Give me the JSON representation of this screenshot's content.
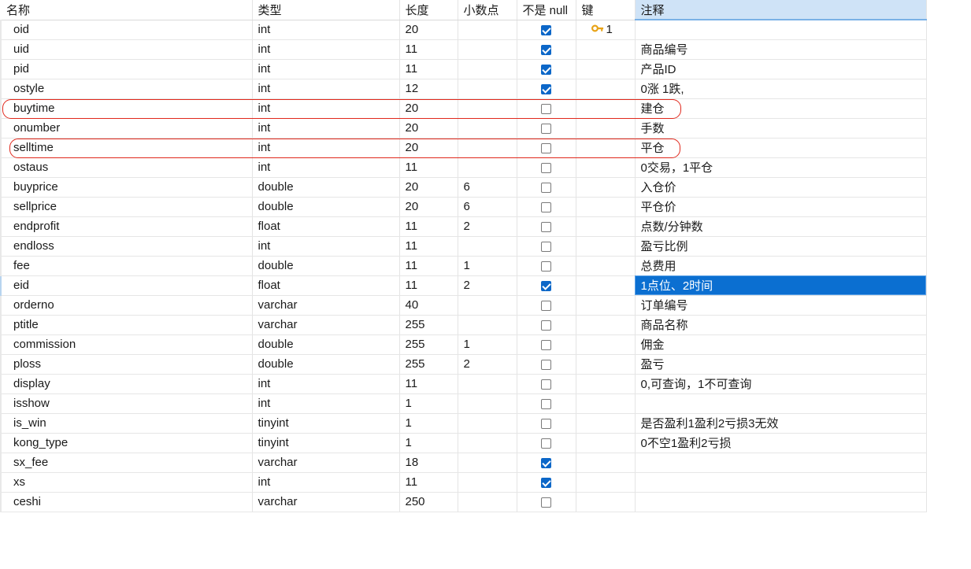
{
  "headers": {
    "name": "名称",
    "type": "类型",
    "length": "长度",
    "decimals": "小数点",
    "not_null": "不是 null",
    "key": "键",
    "comment": "注释"
  },
  "rows": [
    {
      "name": "oid",
      "type": "int",
      "length": "20",
      "decimals": "",
      "not_null": true,
      "key": "1",
      "comment": ""
    },
    {
      "name": "uid",
      "type": "int",
      "length": "11",
      "decimals": "",
      "not_null": true,
      "key": "",
      "comment": "商品编号"
    },
    {
      "name": "pid",
      "type": "int",
      "length": "11",
      "decimals": "",
      "not_null": true,
      "key": "",
      "comment": "产品ID"
    },
    {
      "name": "ostyle",
      "type": "int",
      "length": "12",
      "decimals": "",
      "not_null": true,
      "key": "",
      "comment": "0涨 1跌,"
    },
    {
      "name": "buytime",
      "type": "int",
      "length": "20",
      "decimals": "",
      "not_null": false,
      "key": "",
      "comment": "建仓"
    },
    {
      "name": "onumber",
      "type": "int",
      "length": "20",
      "decimals": "",
      "not_null": false,
      "key": "",
      "comment": "手数"
    },
    {
      "name": "selltime",
      "type": "int",
      "length": "20",
      "decimals": "",
      "not_null": false,
      "key": "",
      "comment": "平仓"
    },
    {
      "name": "ostaus",
      "type": "int",
      "length": "11",
      "decimals": "",
      "not_null": false,
      "key": "",
      "comment": "0交易，1平仓"
    },
    {
      "name": "buyprice",
      "type": "double",
      "length": "20",
      "decimals": "6",
      "not_null": false,
      "key": "",
      "comment": "入仓价"
    },
    {
      "name": "sellprice",
      "type": "double",
      "length": "20",
      "decimals": "6",
      "not_null": false,
      "key": "",
      "comment": "平仓价"
    },
    {
      "name": "endprofit",
      "type": "float",
      "length": "11",
      "decimals": "2",
      "not_null": false,
      "key": "",
      "comment": "点数/分钟数"
    },
    {
      "name": "endloss",
      "type": "int",
      "length": "11",
      "decimals": "",
      "not_null": false,
      "key": "",
      "comment": "盈亏比例"
    },
    {
      "name": "fee",
      "type": "double",
      "length": "11",
      "decimals": "1",
      "not_null": false,
      "key": "",
      "comment": "总费用"
    },
    {
      "name": "eid",
      "type": "float",
      "length": "11",
      "decimals": "2",
      "not_null": true,
      "key": "",
      "comment": "1点位、2时间"
    },
    {
      "name": "orderno",
      "type": "varchar",
      "length": "40",
      "decimals": "",
      "not_null": false,
      "key": "",
      "comment": "订单编号"
    },
    {
      "name": "ptitle",
      "type": "varchar",
      "length": "255",
      "decimals": "",
      "not_null": false,
      "key": "",
      "comment": "商品名称"
    },
    {
      "name": "commission",
      "type": "double",
      "length": "255",
      "decimals": "1",
      "not_null": false,
      "key": "",
      "comment": "佣金"
    },
    {
      "name": "ploss",
      "type": "double",
      "length": "255",
      "decimals": "2",
      "not_null": false,
      "key": "",
      "comment": "盈亏"
    },
    {
      "name": "display",
      "type": "int",
      "length": "11",
      "decimals": "",
      "not_null": false,
      "key": "",
      "comment": "0,可查询，1不可查询"
    },
    {
      "name": "isshow",
      "type": "int",
      "length": "1",
      "decimals": "",
      "not_null": false,
      "key": "",
      "comment": ""
    },
    {
      "name": "is_win",
      "type": "tinyint",
      "length": "1",
      "decimals": "",
      "not_null": false,
      "key": "",
      "comment": "是否盈利1盈利2亏损3无效"
    },
    {
      "name": "kong_type",
      "type": "tinyint",
      "length": "1",
      "decimals": "",
      "not_null": false,
      "key": "",
      "comment": "0不空1盈利2亏损"
    },
    {
      "name": "sx_fee",
      "type": "varchar",
      "length": "18",
      "decimals": "",
      "not_null": true,
      "key": "",
      "comment": ""
    },
    {
      "name": "xs",
      "type": "int",
      "length": "11",
      "decimals": "",
      "not_null": true,
      "key": "",
      "comment": ""
    },
    {
      "name": "ceshi",
      "type": "varchar",
      "length": "250",
      "decimals": "",
      "not_null": false,
      "key": "",
      "comment": ""
    }
  ],
  "selected_row": 13,
  "primary_key_icon": "key-icon",
  "annotations": [
    4,
    6
  ],
  "colors": {
    "selection": "#0b6fd1",
    "header_highlight": "#cfe3f7",
    "checkbox_checked": "#0c67c8",
    "annotation_border": "#e0281c",
    "key_icon": "#e8a317"
  }
}
